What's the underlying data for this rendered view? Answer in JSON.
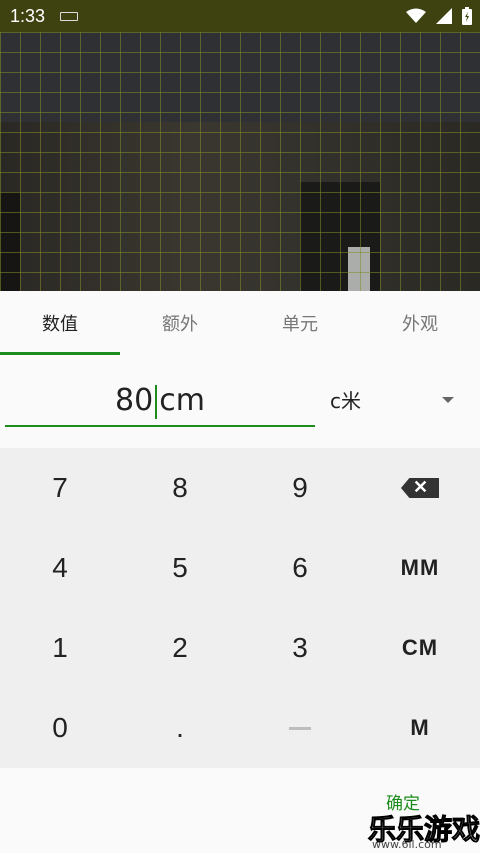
{
  "status_bar": {
    "time": "1:33"
  },
  "tabs": [
    {
      "label": "数值"
    },
    {
      "label": "额外"
    },
    {
      "label": "单元"
    },
    {
      "label": "外观"
    }
  ],
  "input": {
    "number": "80",
    "unit_suffix": "cm"
  },
  "unit_select": {
    "value": "c米"
  },
  "keypad": {
    "keys": [
      "7",
      "8",
      "9",
      "4",
      "5",
      "6",
      "MM",
      "1",
      "2",
      "3",
      "CM",
      "0",
      ".",
      "M"
    ]
  },
  "confirm_label": "确定",
  "watermark": {
    "text": "乐乐游戏",
    "url": "www.6ll.com"
  },
  "colors": {
    "accent": "#1c8c1c",
    "status_bar": "#3d4210"
  }
}
